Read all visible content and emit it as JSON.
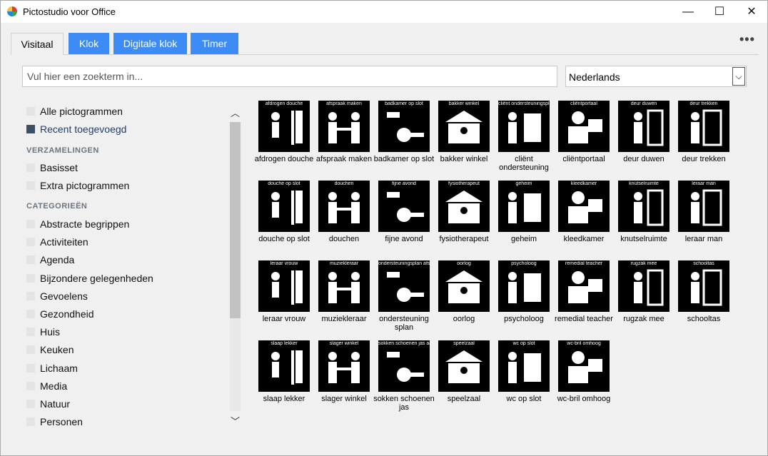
{
  "window": {
    "title": "Pictostudio voor Office",
    "min": "—",
    "max": "☐",
    "close": "✕"
  },
  "tabs": [
    {
      "label": "Visitaal",
      "active": true
    },
    {
      "label": "Klok",
      "active": false
    },
    {
      "label": "Digitale klok",
      "active": false
    },
    {
      "label": "Timer",
      "active": false
    }
  ],
  "more_label": "•••",
  "search": {
    "placeholder": "Vul hier een zoekterm in...",
    "value": ""
  },
  "language": {
    "selected": "Nederlands",
    "arrow": "⌵"
  },
  "sidebar": {
    "top_items": [
      {
        "label": "Alle pictogrammen",
        "checked": false
      },
      {
        "label": "Recent toegevoegd",
        "checked": true
      }
    ],
    "collections_header": "VERZAMELINGEN",
    "collections": [
      {
        "label": "Basisset"
      },
      {
        "label": "Extra pictogrammen"
      }
    ],
    "categories_header": "CATEGORIEËN",
    "categories": [
      {
        "label": "Abstracte begrippen"
      },
      {
        "label": "Activiteiten"
      },
      {
        "label": "Agenda"
      },
      {
        "label": "Bijzondere gelegenheden"
      },
      {
        "label": "Gevoelens"
      },
      {
        "label": "Gezondheid"
      },
      {
        "label": "Huis"
      },
      {
        "label": "Keuken"
      },
      {
        "label": "Lichaam"
      },
      {
        "label": "Media"
      },
      {
        "label": "Natuur"
      },
      {
        "label": "Personen"
      }
    ],
    "scroll_up": "︿",
    "scroll_down": "﹀"
  },
  "pictograms": [
    {
      "top": "afdrogen douche",
      "label": "afdrogen douche"
    },
    {
      "top": "afspraak maken",
      "label": "afspraak maken"
    },
    {
      "top": "badkamer op slot",
      "label": "badkamer op slot"
    },
    {
      "top": "bakker winkel",
      "label": "bakker winkel"
    },
    {
      "top": "cliënt ondersteuningsplan",
      "label": "cliënt ondersteuning"
    },
    {
      "top": "cliëntportaal",
      "label": "cliëntportaal"
    },
    {
      "top": "deur duwen",
      "label": "deur duwen"
    },
    {
      "top": "deur trekken",
      "label": "deur trekken"
    },
    {
      "top": "douche op slot",
      "label": "douche op slot"
    },
    {
      "top": "douchen",
      "label": "douchen"
    },
    {
      "top": "fijne avond",
      "label": "fijne avond"
    },
    {
      "top": "fysiotherapeut",
      "label": "fysiotherapeut"
    },
    {
      "top": "geheim",
      "label": "geheim"
    },
    {
      "top": "kleedkamer",
      "label": "kleedkamer"
    },
    {
      "top": "knutselruimte",
      "label": "knutselruimte"
    },
    {
      "top": "leraar man",
      "label": "leraar man"
    },
    {
      "top": "leraar vrouw",
      "label": "leraar vrouw"
    },
    {
      "top": "muziekleraar",
      "label": "muziekleraar"
    },
    {
      "top": "ondersteuningsplan afspraken",
      "label": "ondersteuning splan"
    },
    {
      "top": "oorlog",
      "label": "oorlog"
    },
    {
      "top": "psycholoog",
      "label": "psycholoog"
    },
    {
      "top": "remedial teacher",
      "label": "remedial teacher"
    },
    {
      "top": "rugzak mee",
      "label": "rugzak mee"
    },
    {
      "top": "schooltas",
      "label": "schooltas"
    },
    {
      "top": "slaap lekker",
      "label": "slaap lekker"
    },
    {
      "top": "slager winkel",
      "label": "slager winkel"
    },
    {
      "top": "sokken schoenen jas aandoen",
      "label": "sokken schoenen jas"
    },
    {
      "top": "speelzaal",
      "label": "speelzaal"
    },
    {
      "top": "wc op slot",
      "label": "wc op slot"
    },
    {
      "top": "wc-bril omhoog",
      "label": "wc-bril omhoog"
    }
  ],
  "colors": {
    "tab_blue": "#3d8cf5",
    "checked_box": "#3c4f63",
    "selected_text": "#1c3e6e"
  }
}
